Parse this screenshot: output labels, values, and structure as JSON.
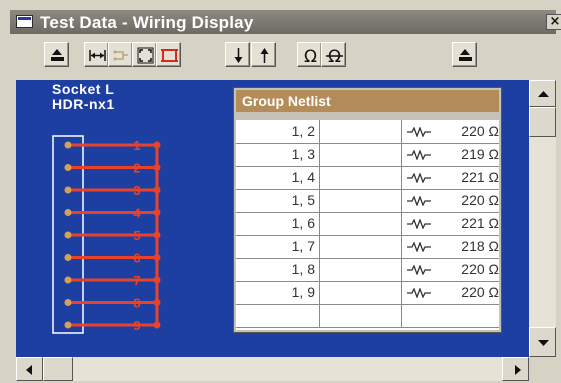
{
  "window": {
    "title": "Test Data - Wiring Display",
    "close_label": "×"
  },
  "toolbar": {
    "buttons": [
      {
        "icon": "tray-up-icon"
      },
      {
        "icon": "fit-width-icon"
      },
      {
        "icon": "link-disabled-icon"
      },
      {
        "icon": "expand-icon"
      },
      {
        "icon": "bracket-red-icon"
      },
      {
        "icon": "arrow-down-icon"
      },
      {
        "icon": "arrow-up-icon"
      },
      {
        "icon": "omega-icon"
      },
      {
        "icon": "omega-strike-icon"
      },
      {
        "icon": "tray-up-icon"
      }
    ]
  },
  "socket": {
    "line1": "Socket L",
    "line2": "HDR-nx1",
    "pins": [
      "1",
      "2",
      "3",
      "4",
      "5",
      "6",
      "7",
      "8",
      "9"
    ],
    "wire_color": "#e8432a"
  },
  "netlist": {
    "header": "Group Netlist",
    "rows": [
      {
        "pins": "1, 2",
        "value": "220 Ω"
      },
      {
        "pins": "1, 3",
        "value": "219 Ω"
      },
      {
        "pins": "1, 4",
        "value": "221 Ω"
      },
      {
        "pins": "1, 5",
        "value": "220 Ω"
      },
      {
        "pins": "1, 6",
        "value": "221 Ω"
      },
      {
        "pins": "1, 7",
        "value": "218 Ω"
      },
      {
        "pins": "1, 8",
        "value": "220 Ω"
      },
      {
        "pins": "1, 9",
        "value": "220 Ω"
      }
    ]
  }
}
